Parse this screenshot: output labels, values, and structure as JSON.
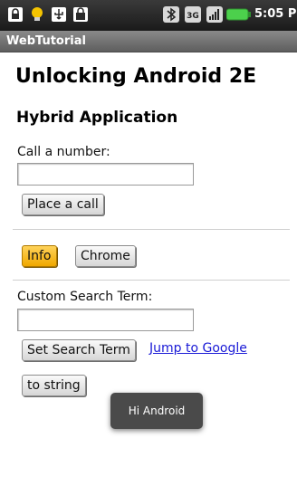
{
  "status_bar": {
    "time": "5:05 PM",
    "icons": [
      "lock-icon",
      "bulb-icon",
      "usb-icon",
      "shopping-bag-icon",
      "bluetooth-icon",
      "3g-icon",
      "signal-icon",
      "battery-icon"
    ],
    "badge_3g": "3G"
  },
  "app": {
    "title": "WebTutorial"
  },
  "content": {
    "heading": "Unlocking Android 2E",
    "subheading": "Hybrid Application",
    "call": {
      "label": "Call a number:",
      "value": "",
      "button": "Place a call"
    },
    "buttons": {
      "info": "Info",
      "chrome": "Chrome"
    },
    "search": {
      "label": "Custom Search Term:",
      "value": "",
      "button": "Set Search Term",
      "link": "Jump to Google"
    },
    "to_string_button": "to string"
  },
  "toast": "Hi Android",
  "colors": {
    "status_bar": "#1a1a1a",
    "title_bar": "#6e6e6e",
    "info_button": "#f0a800",
    "link": "#1a1ad6",
    "battery": "#4cd04c",
    "toast": "#4a4a4a"
  }
}
